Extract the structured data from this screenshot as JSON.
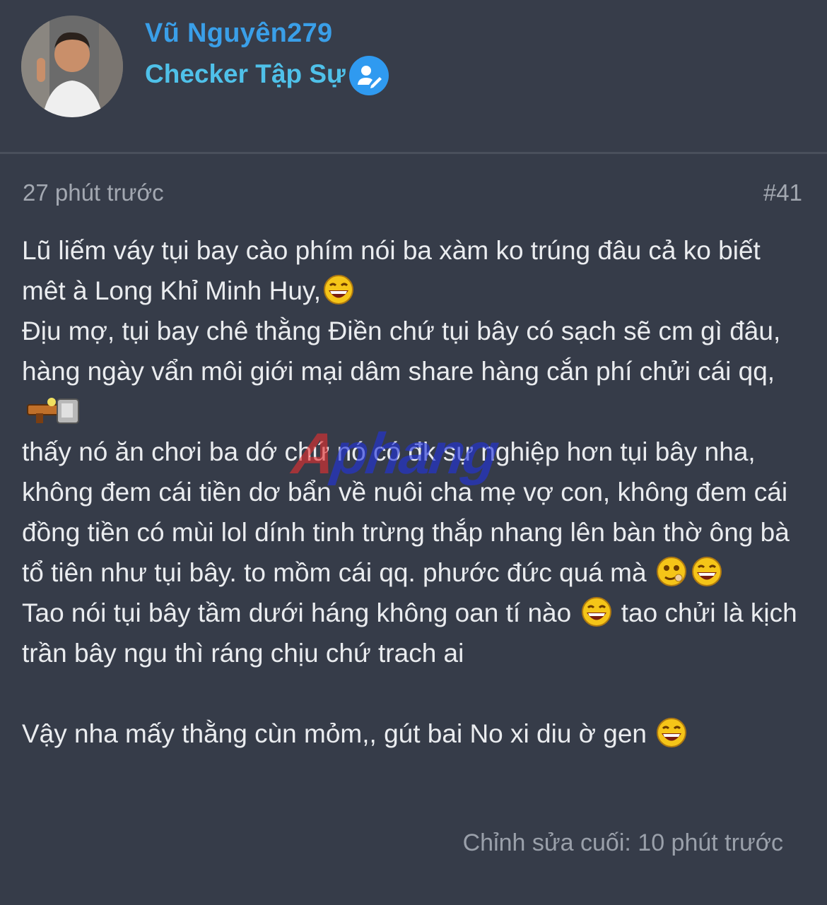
{
  "user": {
    "name": "Vũ Nguyên279",
    "title": "Checker Tập Sự"
  },
  "post": {
    "timestamp": "27 phút trước",
    "number": "#41",
    "para1_text": "Lũ liếm váy tụi bay cào phím nói ba xàm ko trúng đâu cả ko biết mêt à Long Khỉ Minh Huy,",
    "para2_text": "Địu mợ, tụi bay chê thằng Điền chứ tụi bây có sạch sẽ cm gì đâu, hàng ngày vẩn môi giới mại dâm share hàng cắn phí chửi cái qq,",
    "para3_text": "thấy nó ăn chơi ba dớ chứ nó có đk sự nghiệp hơn tụi bây nha, không đem cái tiền dơ bẩn về nuôi cha mẹ vợ con, không đem cái đồng tiền có mùi lol dính tinh trừng thắp nhang lên bàn thờ ông bà tổ tiên như tụi bây. to mồm cái qq. phước đức quá mà",
    "para4_text_a": "Tao nói tụi bây tầm dưới háng không oan tí nào",
    "para4_text_b": "tao chửi là kịch trần bây ngu thì ráng chịu chứ trach ai",
    "para5_text": "Vậy nha mấy thằng cùn mỏm,, gút bai No xi diu ờ gen",
    "edited": "Chỉnh sửa cuối: 10 phút trước"
  },
  "watermark": {
    "part1": "A",
    "part2": "phang"
  },
  "icons": {
    "badge": "user-pen-icon",
    "laugh": "laughing-emoji-icon",
    "gun": "gun-emoji-icon",
    "smirk": "smirk-emoji-icon"
  },
  "colors": {
    "background": "#353b48",
    "username": "#3a9fe8",
    "user_title": "#4fc1e9",
    "badge": "#2f9af0"
  }
}
